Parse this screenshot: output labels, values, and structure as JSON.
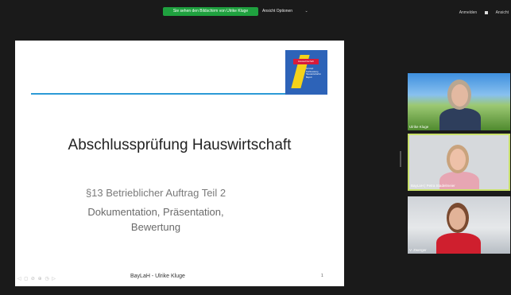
{
  "topbar": {
    "share_banner": "Sie sehen den Bildschirm von Ulrike Kluge",
    "view_options": "Ansicht Optionen",
    "view_chevron": "⌄",
    "right_sign_in": "Anmelden",
    "right_view": "Ansicht"
  },
  "slide": {
    "title": "Abschlussprüfung Hauswirtschaft",
    "subtitle1": "§13 Betrieblicher Auftrag Teil 2",
    "subtitle2": "Dokumentation, Präsentation,",
    "subtitle3": "Bewertung",
    "footer": "BayLaH -  Ulrike Kluge",
    "page_number": "1",
    "controls": "◁ ◻ ⊘ ⊕ ◷ ▷",
    "logo_top": "Hauswirtschaft",
    "logo_lines": "Konzept Fachberatung Hauswirtschaft in Bayern"
  },
  "participants": [
    {
      "name": "Ulrike Kluge"
    },
    {
      "name": "BayLaH | Petra Stadelmeier"
    },
    {
      "name": "V. Zwerger"
    }
  ],
  "colors": {
    "accent_line": "#2c9ad6",
    "share_green": "#1fa13f",
    "active_speaker": "#c8e06a"
  }
}
